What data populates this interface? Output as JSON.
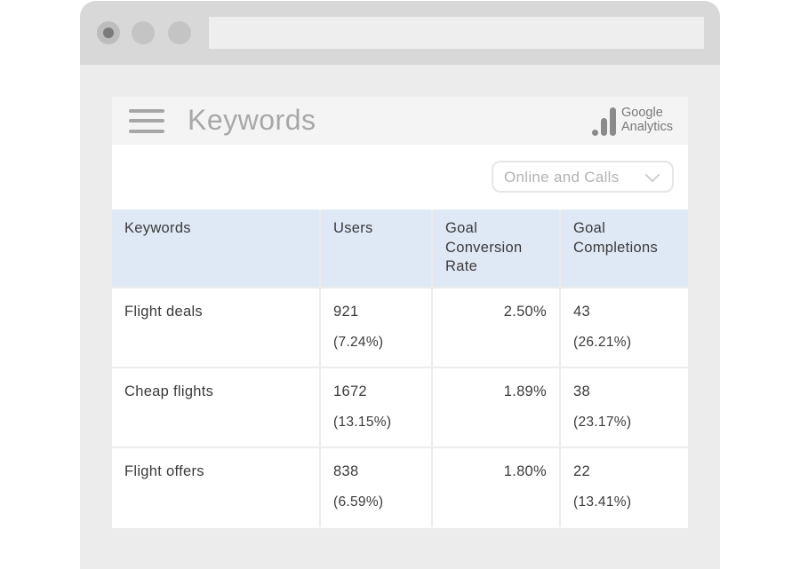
{
  "browser": {
    "window_controls": [
      "close",
      "minimize",
      "maximize"
    ],
    "url": ""
  },
  "header": {
    "menu_icon": "hamburger-menu-icon",
    "title": "Keywords",
    "logo": {
      "line1": "Google",
      "line2": "Analytics",
      "icon": "analytics-bars-icon"
    }
  },
  "filter": {
    "selected": "Online and Calls",
    "icon": "chevron-down-icon"
  },
  "table": {
    "columns": [
      "Keywords",
      "Users",
      "Goal Conversion Rate",
      "Goal Completions"
    ],
    "rows": [
      {
        "keyword": "Flight deals",
        "users": "921",
        "users_pct": "(7.24%)",
        "conversion_rate": "2.50%",
        "completions": "43",
        "completions_pct": "(26.21%)"
      },
      {
        "keyword": "Cheap flights",
        "users": "1672",
        "users_pct": "(13.15%)",
        "conversion_rate": "1.89%",
        "completions": "38",
        "completions_pct": "(23.17%)"
      },
      {
        "keyword": "Flight offers",
        "users": "838",
        "users_pct": "(6.59%)",
        "conversion_rate": "1.80%",
        "completions": "22",
        "completions_pct": "(13.41%)"
      }
    ]
  },
  "colors": {
    "header_row_bg": "#dfe9f6",
    "titlebar_bg": "#d8d8d8",
    "page_bg": "#ececec"
  }
}
